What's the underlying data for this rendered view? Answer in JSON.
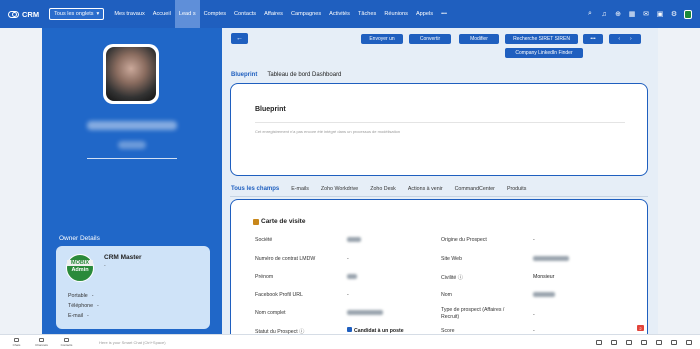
{
  "nav": {
    "brand": "CRM",
    "all_tabs": "Tous les onglets",
    "tabs": [
      "Mes travaux",
      "Accueil",
      "Lead s",
      "Comptes",
      "Contacts",
      "Affaires",
      "Campagnes",
      "Activités",
      "Tâches",
      "Réunions",
      "Appels",
      "•••"
    ],
    "active_tab": "Lead s"
  },
  "owner": {
    "section_title": "Owner Details",
    "logo_line1": "MOBIX",
    "logo_line2": "Admin",
    "name": "CRM Master",
    "dash": "-",
    "rows": [
      {
        "label": "Portable",
        "value": "-"
      },
      {
        "label": "Téléphone",
        "value": "-"
      },
      {
        "label": "E-mail",
        "value": "-"
      }
    ]
  },
  "actions": {
    "envoyer": "Envoyer un",
    "convertir": "Convertir",
    "modifier": "Modifier",
    "siret": "Recherche SIRET SIREN",
    "more": "•••",
    "linkedin": "Company LinkedIn Finder"
  },
  "blueprint": {
    "tab_active": "Blueprint",
    "tab_other": "Tableau de bord Dashboard",
    "title": "Blueprint",
    "description": "Cet enregistrement n'a pas encore été intégré dans un processus de modélisation"
  },
  "detail_tabs": [
    "Tous les champs",
    "E-mails",
    "Zoho Workdrive",
    "Zoho Desk",
    "Actions à venir",
    "CommandCenter",
    "Produits"
  ],
  "visit_card": {
    "title": "Carte de visite",
    "left_fields": [
      {
        "label": "Société",
        "value": ""
      },
      {
        "label": "Numéro de contrat LMDW",
        "value": "-"
      },
      {
        "label": "Prénom",
        "value": ""
      },
      {
        "label": "Facebook Profil URL",
        "value": "-"
      },
      {
        "label": "Nom complet",
        "value": ""
      },
      {
        "label": "Statut du Prospect",
        "value": "Candidat à un poste"
      }
    ],
    "right_fields": [
      {
        "label": "Origine du Prospect",
        "value": "-"
      },
      {
        "label": "Site Web",
        "value": ""
      },
      {
        "label": "Civilité",
        "value": "Monsieur"
      },
      {
        "label": "Nom",
        "value": ""
      },
      {
        "label": "Type de prospect (Affaires / Recruit)",
        "value": "-"
      },
      {
        "label": "Score",
        "value": "-"
      }
    ]
  },
  "bottom": {
    "items": [
      "Chats",
      "Channels",
      "Contacts"
    ],
    "chat_placeholder": "Here is your Smart Chat (Ctrl+Space)",
    "notification_count": "2"
  }
}
